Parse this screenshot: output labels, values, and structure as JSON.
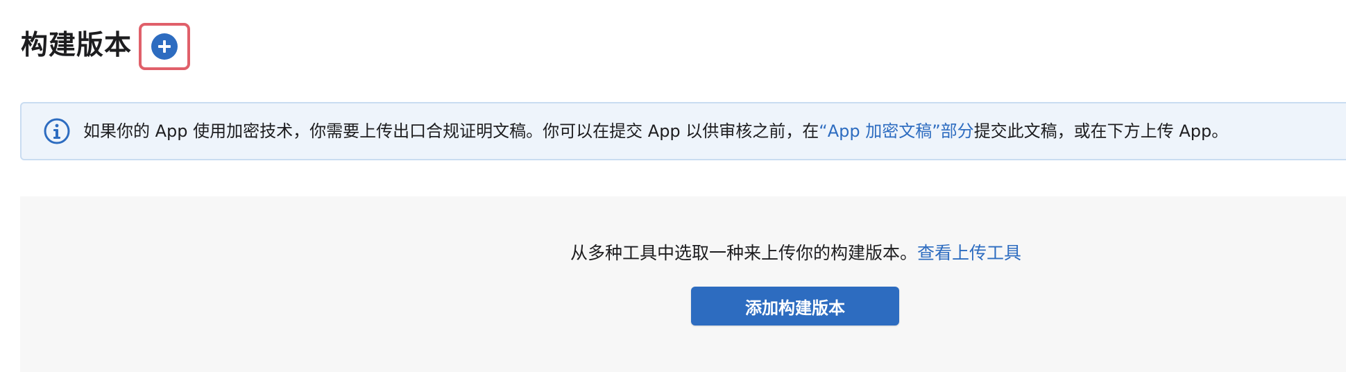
{
  "colors": {
    "accent": "#2d6cc0",
    "highlight_border": "#e0606a",
    "banner_bg": "#eef4fb",
    "banner_border": "#c9dcf1",
    "panel_bg": "#f7f7f7"
  },
  "header": {
    "title": "构建版本",
    "add_icon": "plus-circle-icon"
  },
  "banner": {
    "icon": "info-circle-icon",
    "text_before": "如果你的 App 使用加密技术，你需要上传出口合规证明文稿。你可以在提交 App 以供审核之前，在",
    "link_text": "“App 加密文稿”部分",
    "text_after": "提交此文稿，或在下方上传 App。"
  },
  "upload": {
    "message": "从多种工具中选取一种来上传你的构建版本。",
    "link_text": "查看上传工具",
    "button_label": "添加构建版本"
  }
}
